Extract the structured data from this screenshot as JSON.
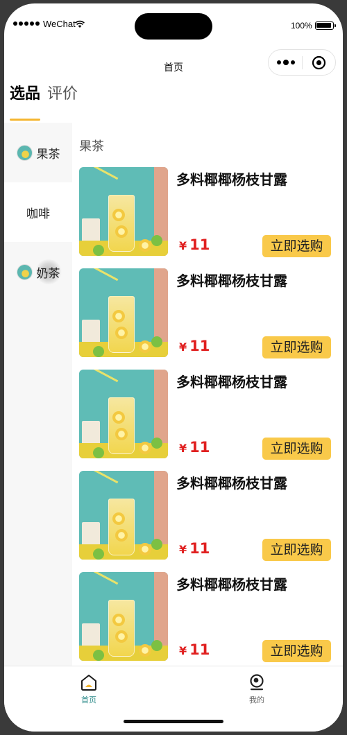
{
  "status_bar": {
    "carrier": "WeChat",
    "battery": "100%",
    "icons": [
      "signal-icon",
      "wifi-icon",
      "battery-icon"
    ]
  },
  "navbar": {
    "title": "首页",
    "capsule_icons": [
      "more-icon",
      "close-target-icon"
    ]
  },
  "tabs": [
    {
      "label": "选品",
      "active": true
    },
    {
      "label": "评价",
      "active": false
    }
  ],
  "sidebar": {
    "items": [
      {
        "label": "果茶",
        "active": false,
        "has_thumb": true
      },
      {
        "label": "咖啡",
        "active": true,
        "has_thumb": false
      },
      {
        "label": "奶茶",
        "active": false,
        "has_thumb": true
      }
    ]
  },
  "section": {
    "title": "果茶"
  },
  "products": [
    {
      "name": "多料椰椰杨枝甘露",
      "currency": "¥",
      "price": "11",
      "button": "立即选购"
    },
    {
      "name": "多料椰椰杨枝甘露",
      "currency": "¥",
      "price": "11",
      "button": "立即选购"
    },
    {
      "name": "多料椰椰杨枝甘露",
      "currency": "¥",
      "price": "11",
      "button": "立即选购"
    },
    {
      "name": "多料椰椰杨枝甘露",
      "currency": "¥",
      "price": "11",
      "button": "立即选购"
    },
    {
      "name": "多料椰椰杨枝甘露",
      "currency": "¥",
      "price": "11",
      "button": "立即选购"
    }
  ],
  "tabbar": {
    "home": {
      "label": "首页",
      "icon": "home-icon",
      "active": true
    },
    "mine": {
      "label": "我的",
      "icon": "profile-icon",
      "active": false
    }
  },
  "colors": {
    "accent": "#f5b630",
    "button": "#f9c94a",
    "price": "#e02020",
    "tab_active": "#2e8b8a"
  }
}
